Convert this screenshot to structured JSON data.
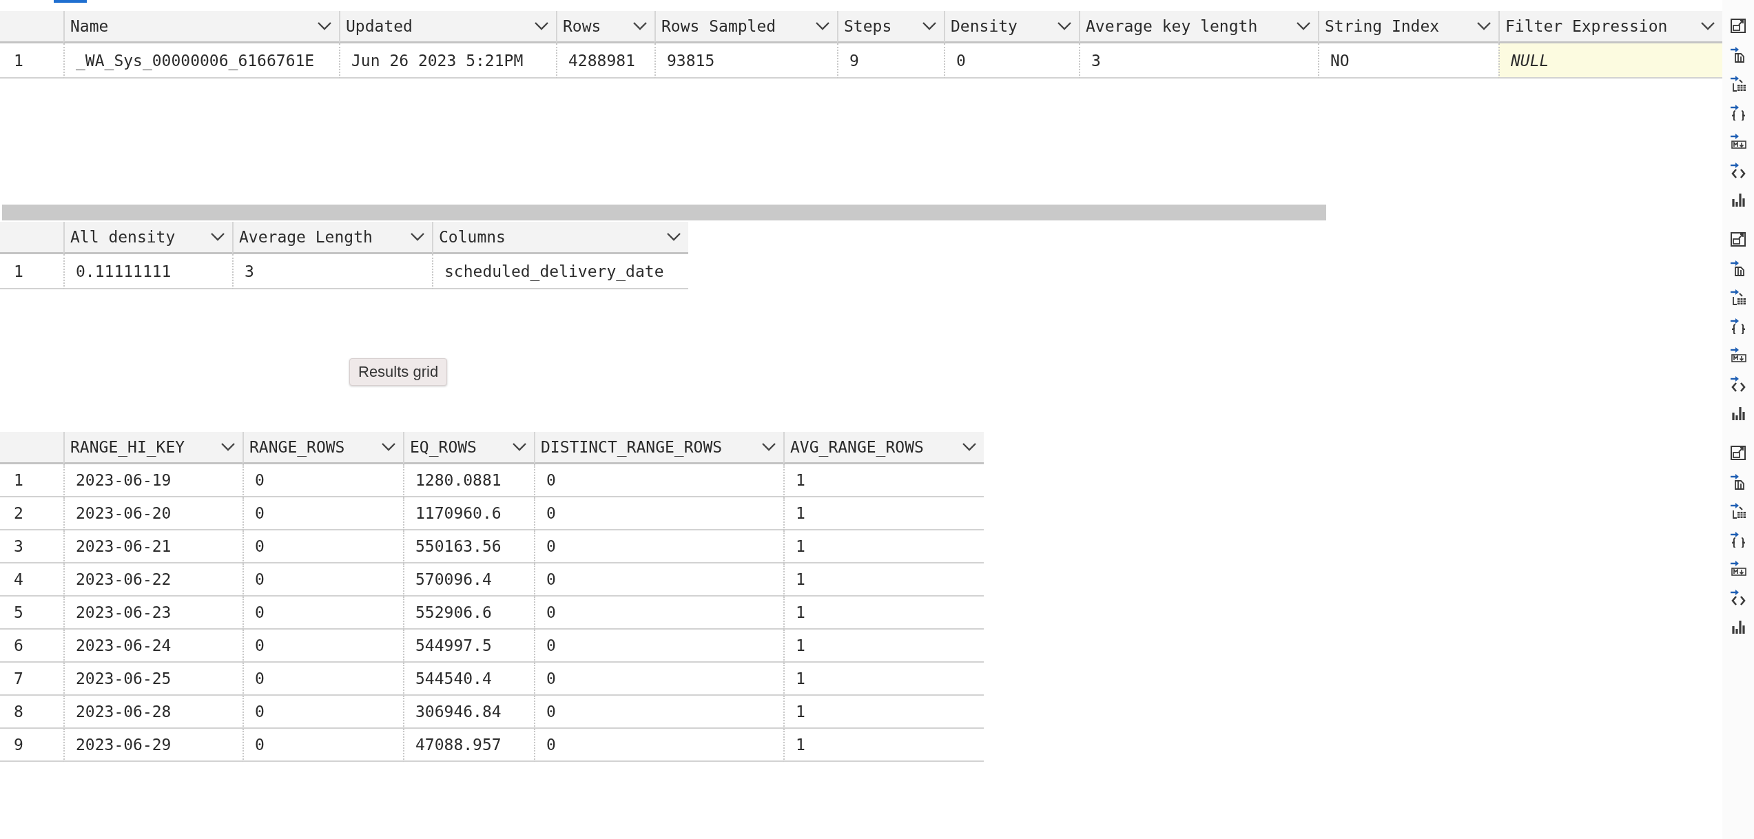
{
  "grids": [
    {
      "columns": [
        {
          "label": "Name",
          "selected": false
        },
        {
          "label": "Updated",
          "selected": false
        },
        {
          "label": "Rows",
          "selected": false
        },
        {
          "label": "Rows Sampled",
          "selected": false
        },
        {
          "label": "Steps",
          "selected": false
        },
        {
          "label": "Density",
          "selected": false
        },
        {
          "label": "Average key length",
          "selected": false
        },
        {
          "label": "String Index",
          "selected": false
        },
        {
          "label": "Filter Expression",
          "selected": true
        }
      ],
      "rows": [
        {
          "number": "1",
          "cells": [
            "_WA_Sys_00000006_6166761E",
            "Jun 26 2023  5:21PM",
            "4288981",
            "93815",
            "9",
            "0",
            "3",
            "NO",
            {
              "text": "NULL",
              "null": true
            }
          ]
        }
      ]
    },
    {
      "columns": [
        {
          "label": "All density",
          "selected": false
        },
        {
          "label": "Average Length",
          "selected": false
        },
        {
          "label": "Columns",
          "selected": false
        }
      ],
      "rows": [
        {
          "number": "1",
          "cells": [
            "0.11111111",
            "3",
            "scheduled_delivery_date"
          ]
        }
      ]
    },
    {
      "columns": [
        {
          "label": "RANGE_HI_KEY",
          "selected": false
        },
        {
          "label": "RANGE_ROWS",
          "selected": false
        },
        {
          "label": "EQ_ROWS",
          "selected": false
        },
        {
          "label": "DISTINCT_RANGE_ROWS",
          "selected": false
        },
        {
          "label": "AVG_RANGE_ROWS",
          "selected": false
        }
      ],
      "rows": [
        {
          "number": "1",
          "cells": [
            "2023-06-19",
            "0",
            "1280.0881",
            "0",
            "1"
          ]
        },
        {
          "number": "2",
          "cells": [
            "2023-06-20",
            "0",
            "1170960.6",
            "0",
            "1"
          ]
        },
        {
          "number": "3",
          "cells": [
            "2023-06-21",
            "0",
            "550163.56",
            "0",
            "1"
          ]
        },
        {
          "number": "4",
          "cells": [
            "2023-06-22",
            "0",
            "570096.4",
            "0",
            "1"
          ]
        },
        {
          "number": "5",
          "cells": [
            "2023-06-23",
            "0",
            "552906.6",
            "0",
            "1"
          ]
        },
        {
          "number": "6",
          "cells": [
            "2023-06-24",
            "0",
            "544997.5",
            "0",
            "1"
          ]
        },
        {
          "number": "7",
          "cells": [
            "2023-06-25",
            "0",
            "544540.4",
            "0",
            "1"
          ]
        },
        {
          "number": "8",
          "cells": [
            "2023-06-28",
            "0",
            "306946.84",
            "0",
            "1"
          ]
        },
        {
          "number": "9",
          "cells": [
            "2023-06-29",
            "0",
            "47088.957",
            "0",
            "1"
          ]
        }
      ]
    }
  ],
  "tooltip": "Results grid"
}
